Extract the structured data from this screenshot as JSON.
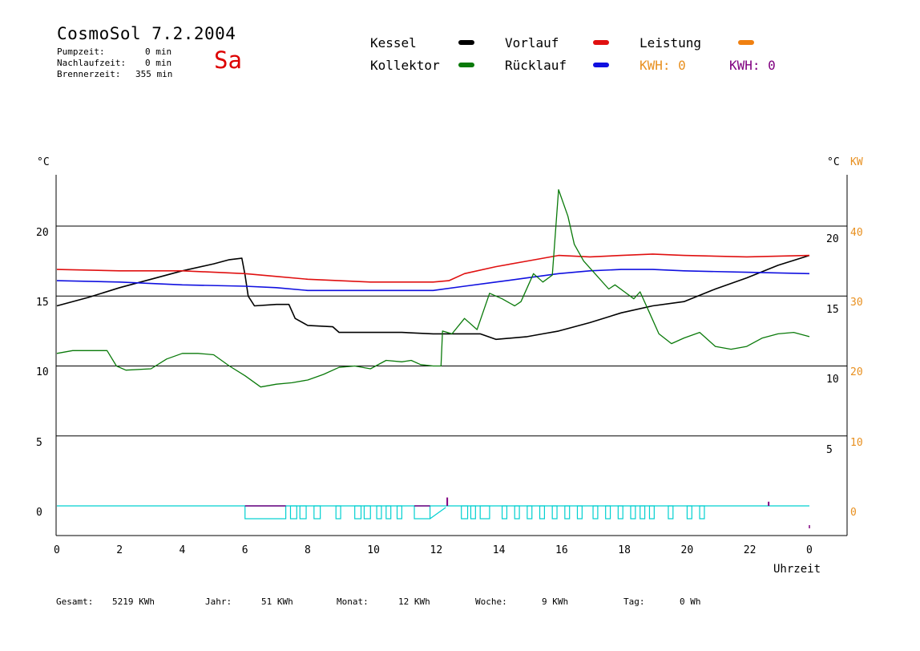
{
  "header": {
    "title": "CosmoSol 7.2.2004",
    "day": "Sa",
    "stats": [
      {
        "label": "Pumpzeit:",
        "value": "0 min"
      },
      {
        "label": "Nachlaufzeit:",
        "value": "0 min"
      },
      {
        "label": "Brennerzeit:",
        "value": "355 min"
      }
    ]
  },
  "legend": {
    "kessel": {
      "label": "Kessel",
      "color": "#000000"
    },
    "kollektor": {
      "label": "Kollektor",
      "color": "#0a7a0a"
    },
    "vorlauf": {
      "label": "Vorlauf",
      "color": "#e01010"
    },
    "ruecklauf": {
      "label": "Rücklauf",
      "color": "#1010e0"
    },
    "leistung": {
      "label": "Leistung",
      "color": "#f08010"
    },
    "kwh1": {
      "label": "KWH: 0",
      "color": "#e89020"
    },
    "kwh2": {
      "label": "KWH: 0",
      "color": "#800080"
    }
  },
  "axes": {
    "left_unit": "°C",
    "right_unit": "°C",
    "right_unit2": "KW",
    "left_ticks": [
      "0",
      "5",
      "10",
      "15",
      "20"
    ],
    "right_temp_ticks": [
      "5",
      "10",
      "15",
      "20"
    ],
    "right_kw_ticks": [
      "0",
      "10",
      "20",
      "30",
      "40"
    ],
    "x_ticks": [
      "0",
      "2",
      "4",
      "6",
      "8",
      "10",
      "12",
      "14",
      "16",
      "18",
      "20",
      "22",
      "0"
    ],
    "x_label": "Uhrzeit"
  },
  "footer": [
    {
      "label": "Gesamt:",
      "value": "5219 KWh"
    },
    {
      "label": "Jahr:",
      "value": "51 KWh"
    },
    {
      "label": "Monat:",
      "value": "12 KWh"
    },
    {
      "label": "Woche:",
      "value": "9 KWh"
    },
    {
      "label": "Tag:",
      "value": "0 Wh"
    }
  ],
  "chart_data": {
    "type": "line",
    "xlabel": "Uhrzeit",
    "ylabel": "°C",
    "xlim": [
      0,
      24
    ],
    "ylim": [
      -2,
      23.5
    ],
    "grid": true,
    "series": [
      {
        "name": "Kessel",
        "color": "#000000",
        "x": [
          0,
          1,
          2,
          3,
          4,
          5,
          5.5,
          5.9,
          6.0,
          6.1,
          6.3,
          7.0,
          7.4,
          7.6,
          8.0,
          8.8,
          9.0,
          10.0,
          11.0,
          12.0,
          12.5,
          13.0,
          13.5,
          14.0,
          15.0,
          15.5,
          16.0,
          16.5,
          17.0,
          18.0,
          19.0,
          20.0,
          21.0,
          22.0,
          23.0,
          24.0
        ],
        "y": [
          14.3,
          14.9,
          15.6,
          16.2,
          16.8,
          17.3,
          17.6,
          17.7,
          16.5,
          15.0,
          14.3,
          14.4,
          14.4,
          13.4,
          12.9,
          12.8,
          12.4,
          12.4,
          12.4,
          12.3,
          12.3,
          12.3,
          12.3,
          11.9,
          12.1,
          12.3,
          12.5,
          12.8,
          13.1,
          13.8,
          14.3,
          14.6,
          15.5,
          16.3,
          17.2,
          17.9
        ]
      },
      {
        "name": "Vorlauf",
        "color": "#e01010",
        "x": [
          0,
          2,
          4,
          6,
          7,
          8,
          10,
          12,
          12.5,
          13,
          14,
          15,
          16,
          17,
          18,
          19,
          20,
          22,
          24
        ],
        "y": [
          16.9,
          16.8,
          16.8,
          16.6,
          16.4,
          16.2,
          16.0,
          16.0,
          16.1,
          16.6,
          17.1,
          17.5,
          17.9,
          17.8,
          17.9,
          18.0,
          17.9,
          17.8,
          17.9
        ]
      },
      {
        "name": "Rücklauf",
        "color": "#1010e0",
        "x": [
          0,
          2,
          4,
          6,
          7,
          8,
          10,
          12,
          13,
          14,
          15,
          16,
          17,
          18,
          19,
          20,
          22,
          24
        ],
        "y": [
          16.1,
          16.0,
          15.8,
          15.7,
          15.6,
          15.4,
          15.4,
          15.4,
          15.7,
          16.0,
          16.3,
          16.6,
          16.8,
          16.9,
          16.9,
          16.8,
          16.7,
          16.6
        ]
      },
      {
        "name": "Kollektor",
        "color": "#0a7a0a",
        "x": [
          0,
          0.5,
          1.0,
          1.6,
          1.9,
          2.2,
          3.0,
          3.5,
          4.0,
          4.5,
          5.0,
          5.5,
          6.0,
          6.5,
          7.0,
          7.5,
          8.0,
          8.5,
          9.0,
          9.5,
          10.0,
          10.5,
          11.0,
          11.3,
          11.6,
          12.0,
          12.25,
          12.3,
          12.6,
          13.0,
          13.4,
          13.8,
          14.2,
          14.6,
          14.8,
          15.2,
          15.5,
          15.8,
          16.0,
          16.3,
          16.5,
          16.8,
          17.2,
          17.6,
          17.8,
          18.1,
          18.4,
          18.6,
          18.9,
          19.2,
          19.6,
          20.0,
          20.5,
          21.0,
          21.5,
          22.0,
          22.5,
          23.0,
          23.5,
          24.0
        ],
        "y": [
          10.9,
          11.1,
          11.1,
          11.1,
          10.0,
          9.7,
          9.8,
          10.5,
          10.9,
          10.9,
          10.8,
          10.0,
          9.3,
          8.5,
          8.7,
          8.8,
          9.0,
          9.4,
          9.9,
          10.0,
          9.8,
          10.4,
          10.3,
          10.4,
          10.1,
          10.0,
          10.0,
          12.5,
          12.3,
          13.4,
          12.6,
          15.2,
          14.8,
          14.3,
          14.6,
          16.6,
          16.0,
          16.5,
          22.6,
          20.7,
          18.7,
          17.5,
          16.5,
          15.5,
          15.8,
          15.3,
          14.8,
          15.3,
          13.8,
          12.3,
          11.6,
          12.0,
          12.4,
          11.4,
          11.2,
          11.4,
          12.0,
          12.3,
          12.4,
          12.1
        ]
      }
    ],
    "pump_blocks": [
      [
        6.0,
        7.3
      ],
      [
        7.45,
        7.65
      ],
      [
        7.75,
        7.95
      ],
      [
        8.2,
        8.4
      ],
      [
        8.9,
        9.05
      ],
      [
        9.5,
        9.7
      ],
      [
        9.8,
        10.0
      ],
      [
        10.2,
        10.35
      ],
      [
        10.5,
        10.65
      ],
      [
        10.85,
        11.0
      ],
      [
        11.4,
        11.9
      ],
      [
        12.9,
        13.1
      ],
      [
        13.2,
        13.35
      ],
      [
        13.5,
        13.8
      ],
      [
        14.2,
        14.35
      ],
      [
        14.6,
        14.75
      ],
      [
        15.0,
        15.15
      ],
      [
        15.4,
        15.55
      ],
      [
        15.8,
        15.95
      ],
      [
        16.2,
        16.35
      ],
      [
        16.6,
        16.75
      ],
      [
        17.1,
        17.25
      ],
      [
        17.5,
        17.65
      ],
      [
        17.9,
        18.05
      ],
      [
        18.3,
        18.45
      ],
      [
        18.6,
        18.75
      ],
      [
        18.9,
        19.05
      ],
      [
        19.5,
        19.65
      ],
      [
        20.1,
        20.25
      ],
      [
        20.5,
        20.65
      ]
    ],
    "kw_markers": [
      {
        "x": 12.45,
        "y": 0.6
      },
      {
        "x": 22.7,
        "y": 0.3
      }
    ]
  }
}
